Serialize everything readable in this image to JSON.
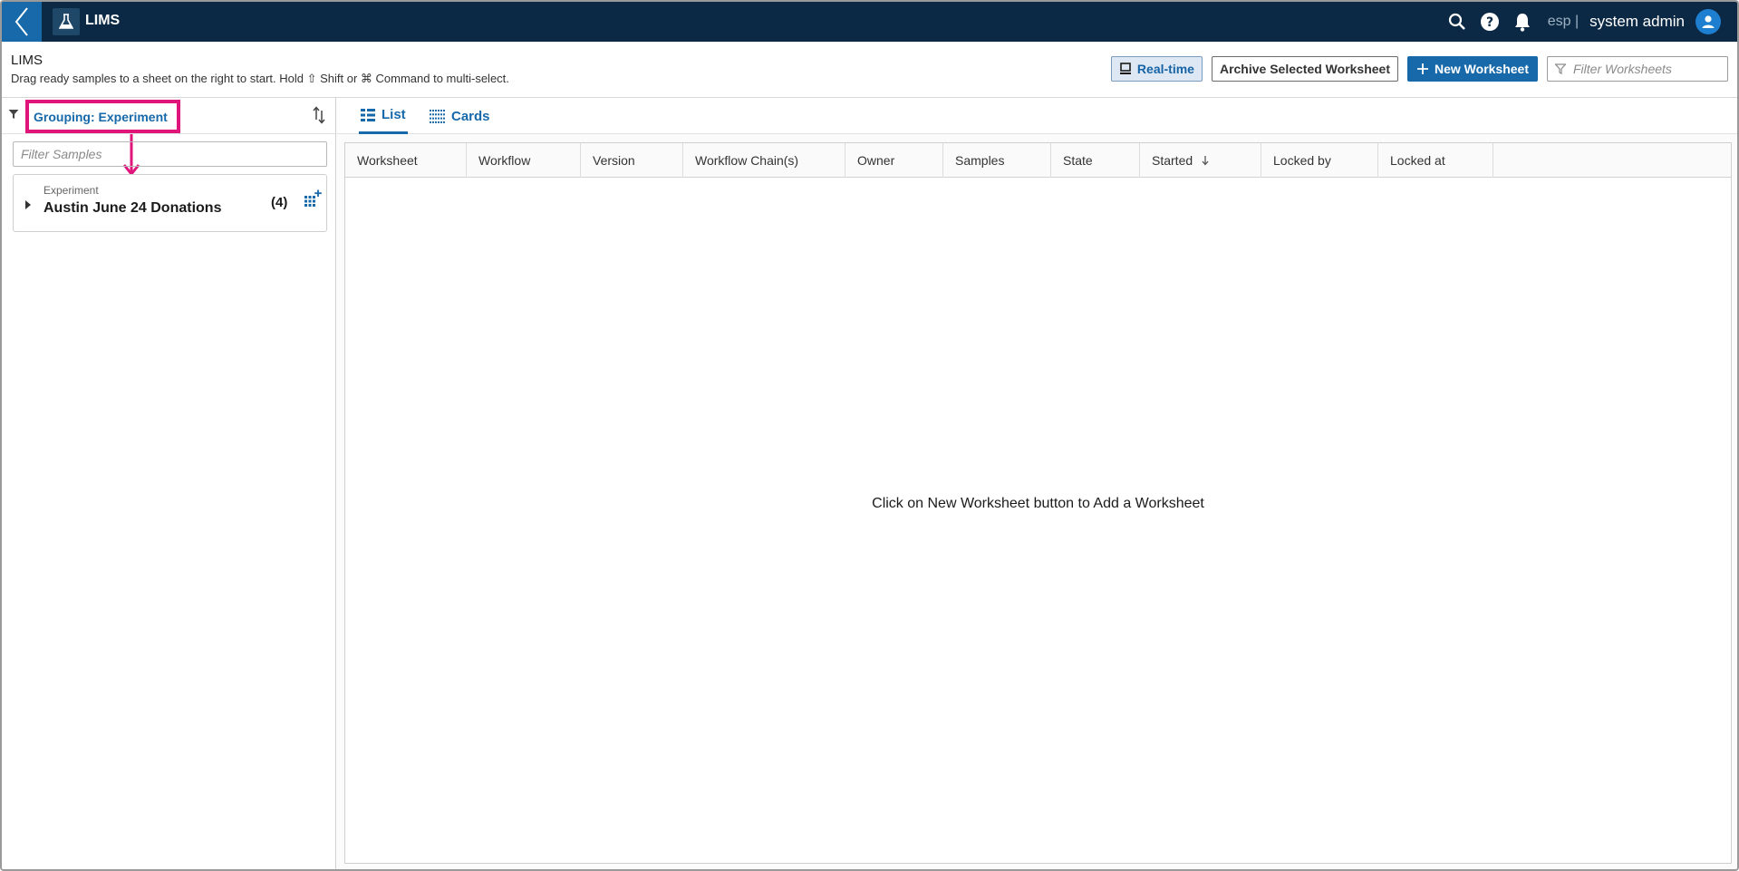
{
  "topbar": {
    "app_name": "LIMS",
    "tenant": "esp |",
    "user_name": "system admin",
    "colors": {
      "bar": "#0b2944",
      "accent": "#1769aa"
    }
  },
  "header": {
    "title": "LIMS",
    "hint": "Drag ready samples to a sheet on the right to start. Hold ⇧ Shift or ⌘ Command to multi-select.",
    "realtime_label": "Real-time",
    "archive_label": "Archive Selected Worksheet",
    "new_label": "New Worksheet",
    "filter_placeholder": "Filter Worksheets"
  },
  "left": {
    "grouping_label": "Grouping: Experiment",
    "filter_placeholder": "Filter Samples",
    "group": {
      "type": "Experiment",
      "name": "Austin June 24 Donations",
      "count": "(4)"
    },
    "highlight_color": "#e0157c"
  },
  "right": {
    "tabs": [
      {
        "label": "List",
        "icon": "list-icon",
        "active": true
      },
      {
        "label": "Cards",
        "icon": "cards-grid-icon",
        "active": false
      }
    ],
    "columns": [
      "Worksheet",
      "Workflow",
      "Version",
      "Workflow Chain(s)",
      "Owner",
      "Samples",
      "State",
      "Started",
      "Locked by",
      "Locked at"
    ],
    "sorted_column": "Started",
    "empty_message": "Click on New Worksheet button to Add a Worksheet"
  }
}
